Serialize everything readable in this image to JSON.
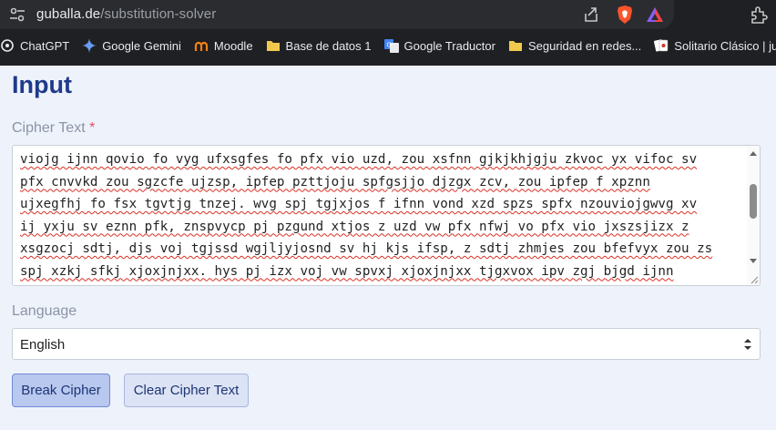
{
  "browser": {
    "url_domain": "guballa.de",
    "url_path": "/substitution-solver",
    "bookmarks": [
      {
        "label": "ChatGPT",
        "icon": "chatgpt-icon"
      },
      {
        "label": "Google Gemini",
        "icon": "gemini-icon"
      },
      {
        "label": "Moodle",
        "icon": "moodle-icon"
      },
      {
        "label": "Base de datos 1",
        "icon": "folder-icon"
      },
      {
        "label": "Google Traductor",
        "icon": "translate-icon"
      },
      {
        "label": "Seguridad en redes...",
        "icon": "folder-icon"
      },
      {
        "label": "Solitario Clásico | ju...",
        "icon": "cards-icon"
      }
    ]
  },
  "page": {
    "title": "Input",
    "cipher_label": "Cipher Text",
    "cipher_required_mark": "*",
    "cipher_text": "viojg ijnn qovio fo vyg ufxsgfes fo pfx vio uzd, zou xsfnn gjkjkhjgju zkvoc yx vifoc sv\npfx cnvvkd zou sgzcfe ujzsp, ipfep pzttjoju spfgsjjo djzgx zcv, zou ipfep f xpznn\nujxegfhj fo fsx tgvtjg tnzej. wvg spj tgjxjos f ifnn vond xzd spzs spfx nzouviojgwvg xv\nij yxju sv eznn pfk, znspvycp pj pzgund xtjos z uzd vw pfx nfwj vo pfx vio jxszsjizx z\nxsgzocj sdtj, djs voj tgjssd wgjljyjosnd sv hj kjs ifsp, z sdtj zhmjes zou bfefvyx zou zs\nspj xzkj sfkj xjoxjnjxx. hys pj izx voj vw spvxj xjoxjnjxx tjgxvox ipv zgj bjgd ijnn\nzhnj sv nvvf zwsjg spjfg viu zwwzfgx, zou sv uv fs tgvtjgnd.",
    "language_label": "Language",
    "language_value": "English",
    "break_button": "Break Cipher",
    "clear_button": "Clear Cipher Text"
  },
  "colors": {
    "title": "#1e3a8a",
    "background": "#eef2fb",
    "required": "#e05260",
    "primary_button": "#b8c8ee",
    "secondary_button": "#dce3f5"
  }
}
